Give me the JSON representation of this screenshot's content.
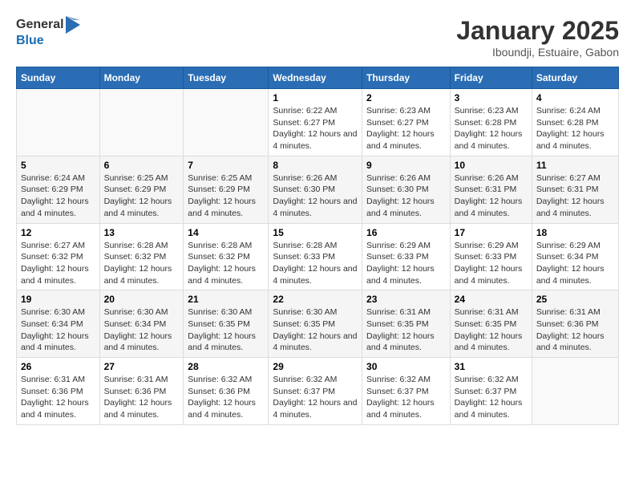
{
  "header": {
    "logo_text_general": "General",
    "logo_text_blue": "Blue",
    "month_title": "January 2025",
    "subtitle": "Iboundji, Estuaire, Gabon"
  },
  "weekdays": [
    "Sunday",
    "Monday",
    "Tuesday",
    "Wednesday",
    "Thursday",
    "Friday",
    "Saturday"
  ],
  "weeks": [
    [
      {
        "day": "",
        "sunrise": "",
        "sunset": "",
        "daylight": ""
      },
      {
        "day": "",
        "sunrise": "",
        "sunset": "",
        "daylight": ""
      },
      {
        "day": "",
        "sunrise": "",
        "sunset": "",
        "daylight": ""
      },
      {
        "day": "1",
        "sunrise": "Sunrise: 6:22 AM",
        "sunset": "Sunset: 6:27 PM",
        "daylight": "Daylight: 12 hours and 4 minutes."
      },
      {
        "day": "2",
        "sunrise": "Sunrise: 6:23 AM",
        "sunset": "Sunset: 6:27 PM",
        "daylight": "Daylight: 12 hours and 4 minutes."
      },
      {
        "day": "3",
        "sunrise": "Sunrise: 6:23 AM",
        "sunset": "Sunset: 6:28 PM",
        "daylight": "Daylight: 12 hours and 4 minutes."
      },
      {
        "day": "4",
        "sunrise": "Sunrise: 6:24 AM",
        "sunset": "Sunset: 6:28 PM",
        "daylight": "Daylight: 12 hours and 4 minutes."
      }
    ],
    [
      {
        "day": "5",
        "sunrise": "Sunrise: 6:24 AM",
        "sunset": "Sunset: 6:29 PM",
        "daylight": "Daylight: 12 hours and 4 minutes."
      },
      {
        "day": "6",
        "sunrise": "Sunrise: 6:25 AM",
        "sunset": "Sunset: 6:29 PM",
        "daylight": "Daylight: 12 hours and 4 minutes."
      },
      {
        "day": "7",
        "sunrise": "Sunrise: 6:25 AM",
        "sunset": "Sunset: 6:29 PM",
        "daylight": "Daylight: 12 hours and 4 minutes."
      },
      {
        "day": "8",
        "sunrise": "Sunrise: 6:26 AM",
        "sunset": "Sunset: 6:30 PM",
        "daylight": "Daylight: 12 hours and 4 minutes."
      },
      {
        "day": "9",
        "sunrise": "Sunrise: 6:26 AM",
        "sunset": "Sunset: 6:30 PM",
        "daylight": "Daylight: 12 hours and 4 minutes."
      },
      {
        "day": "10",
        "sunrise": "Sunrise: 6:26 AM",
        "sunset": "Sunset: 6:31 PM",
        "daylight": "Daylight: 12 hours and 4 minutes."
      },
      {
        "day": "11",
        "sunrise": "Sunrise: 6:27 AM",
        "sunset": "Sunset: 6:31 PM",
        "daylight": "Daylight: 12 hours and 4 minutes."
      }
    ],
    [
      {
        "day": "12",
        "sunrise": "Sunrise: 6:27 AM",
        "sunset": "Sunset: 6:32 PM",
        "daylight": "Daylight: 12 hours and 4 minutes."
      },
      {
        "day": "13",
        "sunrise": "Sunrise: 6:28 AM",
        "sunset": "Sunset: 6:32 PM",
        "daylight": "Daylight: 12 hours and 4 minutes."
      },
      {
        "day": "14",
        "sunrise": "Sunrise: 6:28 AM",
        "sunset": "Sunset: 6:32 PM",
        "daylight": "Daylight: 12 hours and 4 minutes."
      },
      {
        "day": "15",
        "sunrise": "Sunrise: 6:28 AM",
        "sunset": "Sunset: 6:33 PM",
        "daylight": "Daylight: 12 hours and 4 minutes."
      },
      {
        "day": "16",
        "sunrise": "Sunrise: 6:29 AM",
        "sunset": "Sunset: 6:33 PM",
        "daylight": "Daylight: 12 hours and 4 minutes."
      },
      {
        "day": "17",
        "sunrise": "Sunrise: 6:29 AM",
        "sunset": "Sunset: 6:33 PM",
        "daylight": "Daylight: 12 hours and 4 minutes."
      },
      {
        "day": "18",
        "sunrise": "Sunrise: 6:29 AM",
        "sunset": "Sunset: 6:34 PM",
        "daylight": "Daylight: 12 hours and 4 minutes."
      }
    ],
    [
      {
        "day": "19",
        "sunrise": "Sunrise: 6:30 AM",
        "sunset": "Sunset: 6:34 PM",
        "daylight": "Daylight: 12 hours and 4 minutes."
      },
      {
        "day": "20",
        "sunrise": "Sunrise: 6:30 AM",
        "sunset": "Sunset: 6:34 PM",
        "daylight": "Daylight: 12 hours and 4 minutes."
      },
      {
        "day": "21",
        "sunrise": "Sunrise: 6:30 AM",
        "sunset": "Sunset: 6:35 PM",
        "daylight": "Daylight: 12 hours and 4 minutes."
      },
      {
        "day": "22",
        "sunrise": "Sunrise: 6:30 AM",
        "sunset": "Sunset: 6:35 PM",
        "daylight": "Daylight: 12 hours and 4 minutes."
      },
      {
        "day": "23",
        "sunrise": "Sunrise: 6:31 AM",
        "sunset": "Sunset: 6:35 PM",
        "daylight": "Daylight: 12 hours and 4 minutes."
      },
      {
        "day": "24",
        "sunrise": "Sunrise: 6:31 AM",
        "sunset": "Sunset: 6:35 PM",
        "daylight": "Daylight: 12 hours and 4 minutes."
      },
      {
        "day": "25",
        "sunrise": "Sunrise: 6:31 AM",
        "sunset": "Sunset: 6:36 PM",
        "daylight": "Daylight: 12 hours and 4 minutes."
      }
    ],
    [
      {
        "day": "26",
        "sunrise": "Sunrise: 6:31 AM",
        "sunset": "Sunset: 6:36 PM",
        "daylight": "Daylight: 12 hours and 4 minutes."
      },
      {
        "day": "27",
        "sunrise": "Sunrise: 6:31 AM",
        "sunset": "Sunset: 6:36 PM",
        "daylight": "Daylight: 12 hours and 4 minutes."
      },
      {
        "day": "28",
        "sunrise": "Sunrise: 6:32 AM",
        "sunset": "Sunset: 6:36 PM",
        "daylight": "Daylight: 12 hours and 4 minutes."
      },
      {
        "day": "29",
        "sunrise": "Sunrise: 6:32 AM",
        "sunset": "Sunset: 6:37 PM",
        "daylight": "Daylight: 12 hours and 4 minutes."
      },
      {
        "day": "30",
        "sunrise": "Sunrise: 6:32 AM",
        "sunset": "Sunset: 6:37 PM",
        "daylight": "Daylight: 12 hours and 4 minutes."
      },
      {
        "day": "31",
        "sunrise": "Sunrise: 6:32 AM",
        "sunset": "Sunset: 6:37 PM",
        "daylight": "Daylight: 12 hours and 4 minutes."
      },
      {
        "day": "",
        "sunrise": "",
        "sunset": "",
        "daylight": ""
      }
    ]
  ]
}
